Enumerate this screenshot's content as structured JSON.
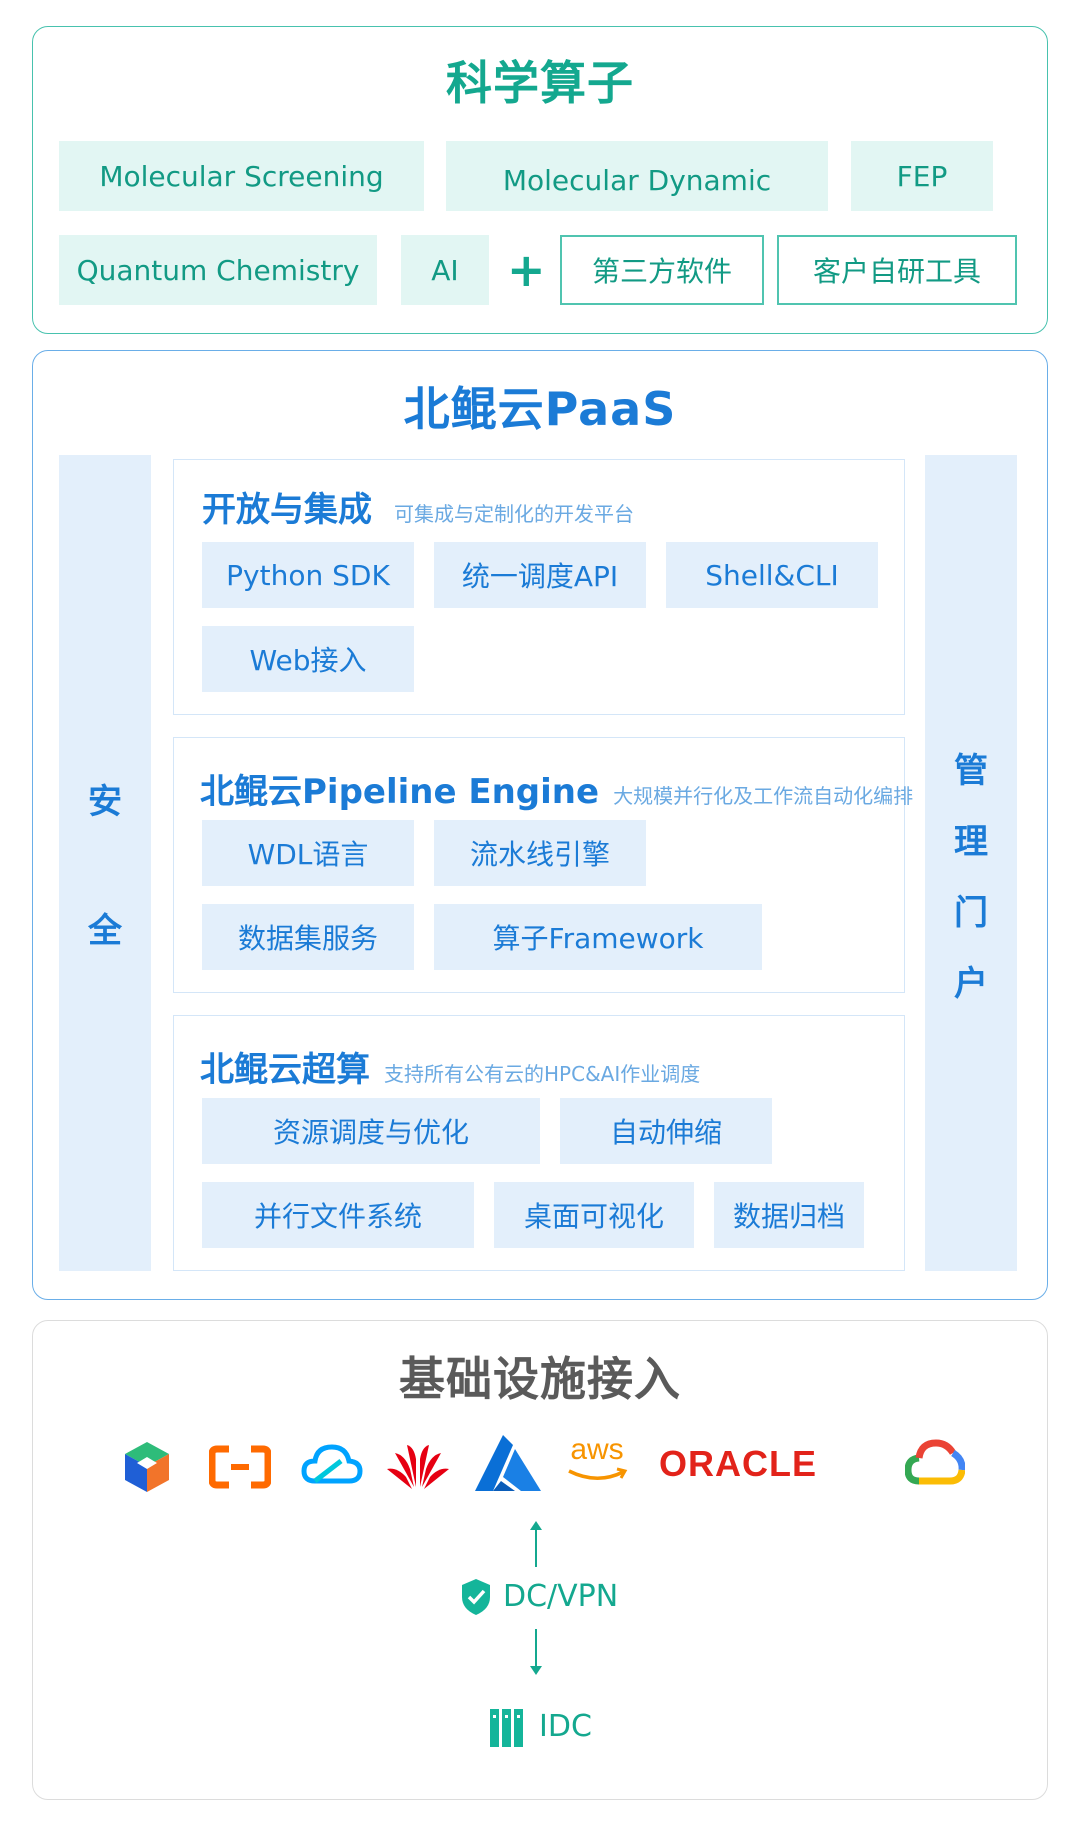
{
  "science": {
    "title": "科学算子",
    "row1": [
      "Molecular Screening",
      "Molecular Dynamic",
      "FEP"
    ],
    "row2": [
      "Quantum Chemistry",
      "AI"
    ],
    "plus": "+",
    "outlined": [
      "第三方软件",
      "客户自研工具"
    ]
  },
  "paas": {
    "title": "北鲲云PaaS",
    "left_bar": [
      "安",
      "全"
    ],
    "right_bar": [
      "管",
      "理",
      "门",
      "户"
    ],
    "open": {
      "title": "开放与集成",
      "desc": "可集成与定制化的开发平台",
      "items": [
        "Python SDK",
        "统一调度API",
        "Shell&CLI",
        "Web接入"
      ]
    },
    "pipeline": {
      "title": "北鲲云Pipeline Engine",
      "desc": "大规模并行化及工作流自动化编排",
      "items": [
        "WDL语言",
        "流水线引擎",
        "数据集服务",
        "算子Framework"
      ]
    },
    "hpc": {
      "title": "北鲲云超算",
      "desc": "支持所有公有云的HPC&AI作业调度",
      "items": [
        "资源调度与优化",
        "自动伸缩",
        "并行文件系统",
        "桌面可视化",
        "数据归档"
      ]
    }
  },
  "infra": {
    "title": "基础设施接入",
    "aws": "aws",
    "oracle": "ORACLE",
    "dcvpn": "DC/VPN",
    "idc": "IDC"
  },
  "colors": {
    "teal": "#14a88f",
    "blue": "#1b7bd6",
    "gray_title": "#5a5a5a"
  }
}
